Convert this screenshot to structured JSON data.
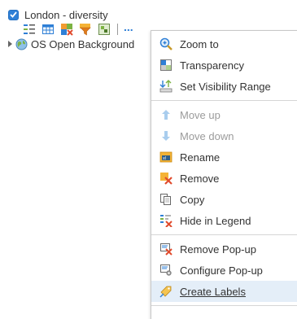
{
  "layer": {
    "title": "London - diversity",
    "checked": true,
    "more_label": "..."
  },
  "basemap": {
    "title": "OS Open Background"
  },
  "toolbar_icons": [
    "legend-icon",
    "attribute-table-icon",
    "change-style-icon",
    "filter-icon",
    "analysis-icon"
  ],
  "menu": {
    "items": [
      {
        "label": "Zoom to",
        "icon": "zoom-to-icon"
      },
      {
        "label": "Transparency",
        "icon": "transparency-icon"
      },
      {
        "label": "Set Visibility Range",
        "icon": "visibility-range-icon"
      },
      {
        "label": "Move up",
        "icon": "arrow-up-icon",
        "disabled": true
      },
      {
        "label": "Move down",
        "icon": "arrow-down-icon",
        "disabled": true
      },
      {
        "label": "Rename",
        "icon": "rename-icon"
      },
      {
        "label": "Remove",
        "icon": "remove-icon"
      },
      {
        "label": "Copy",
        "icon": "copy-icon"
      },
      {
        "label": "Hide in Legend",
        "icon": "hide-legend-icon"
      },
      {
        "label": "Remove Pop-up",
        "icon": "remove-popup-icon"
      },
      {
        "label": "Configure Pop-up",
        "icon": "configure-popup-icon"
      },
      {
        "label": "Create Labels",
        "icon": "create-labels-icon",
        "hovered": true
      }
    ]
  },
  "colors": {
    "accent": "#2e7fd6",
    "hover_bg": "#e4eef8",
    "disabled_text": "#9b9b9b"
  }
}
